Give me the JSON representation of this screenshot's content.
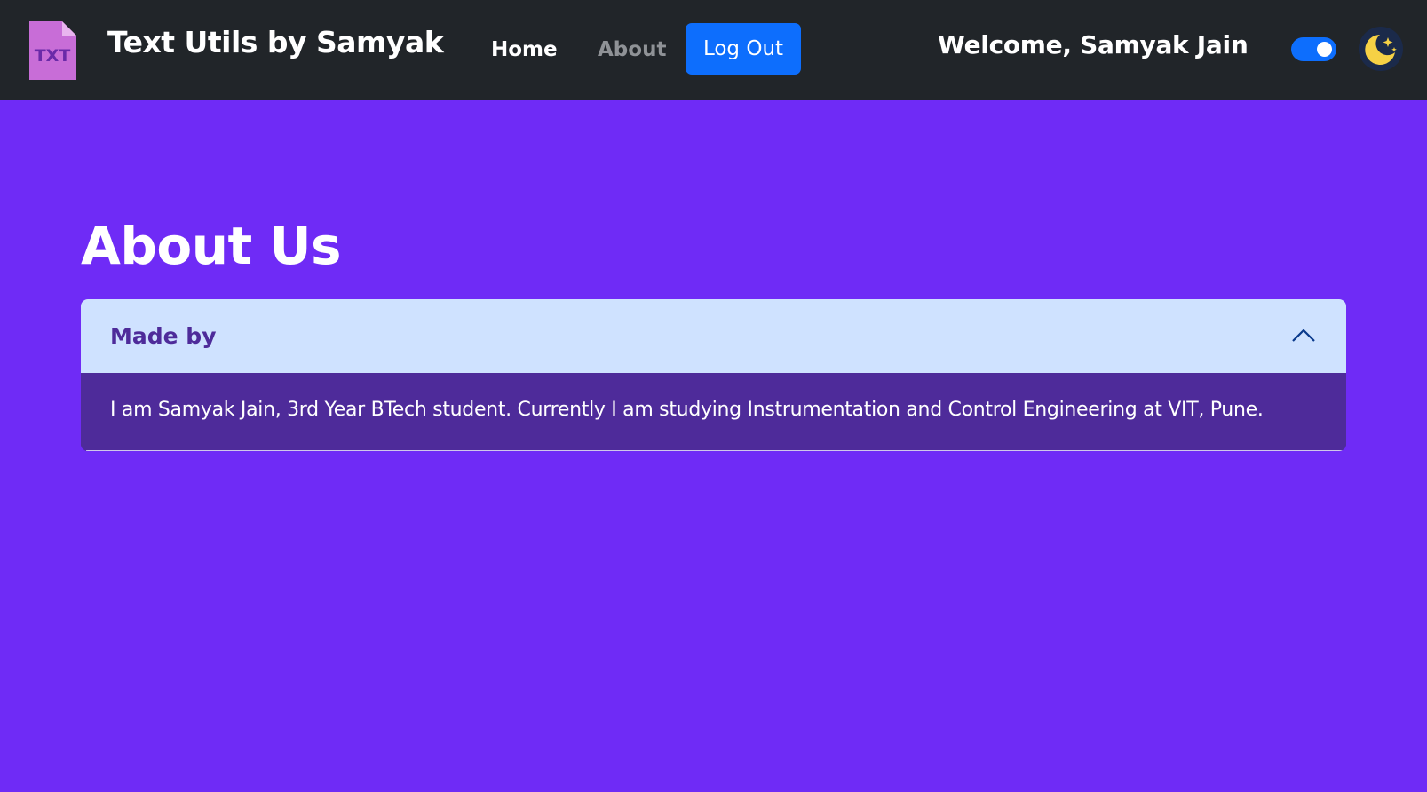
{
  "navbar": {
    "logo_text": "TXT",
    "brand": "Text Utils by Samyak",
    "links": [
      {
        "label": "Home"
      },
      {
        "label": "About"
      }
    ],
    "logout_label": "Log Out",
    "welcome": "Welcome, Samyak Jain",
    "dark_mode_toggle_on": true,
    "theme_icon": "moon-stars-icon"
  },
  "main": {
    "title": "About Us",
    "accordion": {
      "header": "Made by",
      "expanded": true,
      "chevron_icon": "chevron-up-icon",
      "body": "I am Samyak Jain, 3rd Year BTech student. Currently I am studying Instrumentation and Control Engineering at VIT, Pune."
    }
  },
  "colors": {
    "navbar_bg": "#212529",
    "page_bg": "#6f2bf6",
    "primary": "#0d6efd",
    "accordion_header_bg": "#cfe2ff",
    "accordion_body_bg": "#4e2b9a",
    "logo": "#c86dd7",
    "moon": "#f6d145"
  }
}
